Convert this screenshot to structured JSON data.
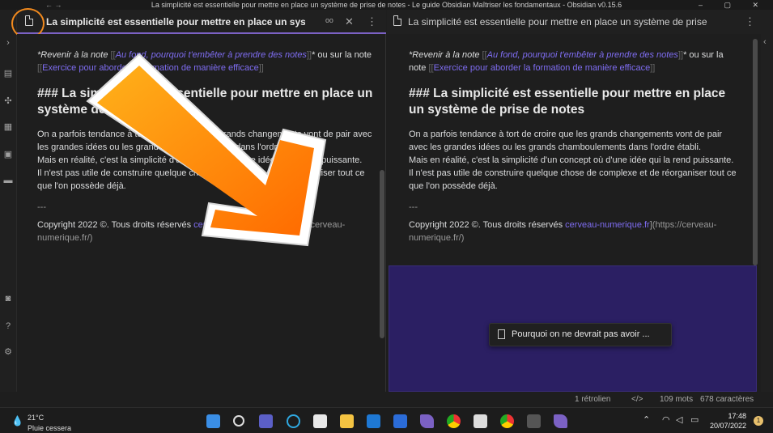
{
  "window": {
    "title": "La simplicité est essentielle pour mettre en place un système de prise de notes - Le guide Obsidian Maîtriser les fondamentaux - Obsidian v0.15.6",
    "nav_arrows": "←  →",
    "controls": "–  ▢  ✕"
  },
  "tabs": {
    "left_title": "La simplicité est essentielle pour mettre en place un système de prise de notes",
    "right_title": "La simplicité est essentielle pour mettre en place un système de prise de notes"
  },
  "note": {
    "back_prefix": "*Revenir à la note ",
    "link_bracket_open": "[[",
    "link1": "Au fond, pourquoi t'embêter à prendre des notes",
    "link_bracket_close": "]]",
    "mid_text": "* ou sur la note ",
    "link2": "Exercice pour aborder la formation de manière efficace",
    "heading": "### La simplicité est essentielle pour mettre en place un système de prise de notes",
    "para1": "On a parfois tendance à tort de croire que les grands changements vont de pair avec les grandes idées ou les grands chamboulements dans l'ordre établi.",
    "para2": "Mais en réalité, c'est la simplicité d'un concept où d'une idée qui la rend puissante.",
    "para3": "Il n'est pas utile de construire quelque chose de complexe et de réorganiser tout ce que l'on possède déjà.",
    "hr": "---",
    "copyright_prefix": "Copyright 2022 ©. Tous droits réservés ",
    "copyright_link": "cerveau-numerique.fr",
    "copyright_url": "](https://cerveau-numerique.fr/)"
  },
  "hover_preview": {
    "label": "Pourquoi on ne devrait pas avoir ..."
  },
  "status": {
    "backlinks": "1 rétrolien",
    "code": "</>",
    "words": "109 mots",
    "chars": "678 caractères"
  },
  "taskbar": {
    "temperature": "21°C",
    "weather": "Pluie cessera",
    "time": "17:48",
    "date": "20/07/2022",
    "notification_count": "1"
  },
  "colors": {
    "accent": "#7f6df2",
    "preview_bg": "#2b1f63",
    "arrow_orange": "#f28a1e"
  }
}
